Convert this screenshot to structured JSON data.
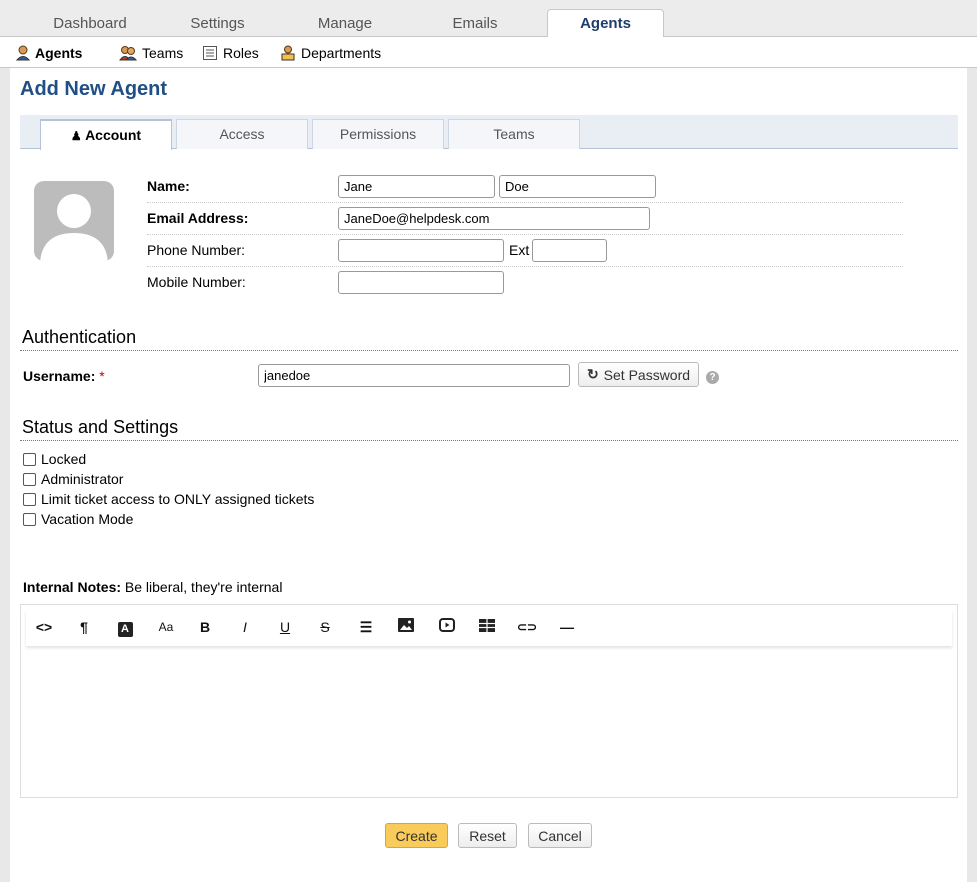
{
  "top_tabs": [
    "Dashboard",
    "Settings",
    "Manage",
    "Emails",
    "Agents"
  ],
  "sub_nav": [
    "Agents",
    "Teams",
    "Roles",
    "Departments"
  ],
  "page_title": "Add New Agent",
  "form_tabs": [
    "Account",
    "Access",
    "Permissions",
    "Teams"
  ],
  "account": {
    "name_label": "Name:",
    "first_name": "Jane",
    "last_name": "Doe",
    "email_label": "Email Address:",
    "email": "JaneDoe@helpdesk.com",
    "phone_label": "Phone Number:",
    "phone": "",
    "ext_label": "Ext",
    "ext": "",
    "mobile_label": "Mobile Number:",
    "mobile": ""
  },
  "auth": {
    "heading": "Authentication",
    "username_label": "Username:",
    "required_mark": "*",
    "username": "janedoe",
    "set_password": "Set Password"
  },
  "status": {
    "heading": "Status and Settings",
    "options": [
      "Locked",
      "Administrator",
      "Limit ticket access to ONLY assigned tickets",
      "Vacation Mode"
    ]
  },
  "notes": {
    "label": "Internal Notes:",
    "hint": "Be liberal, they're internal"
  },
  "toolbar_icons": [
    "code-view",
    "paragraph",
    "font-color",
    "font-size",
    "bold",
    "italic",
    "underline",
    "strikethrough",
    "list",
    "image",
    "video",
    "table",
    "link",
    "horizontal-rule"
  ],
  "toolbar_glyphs": {
    "code": "<>",
    "paragraph": "¶",
    "font_color": "A",
    "font_size": "Aa",
    "bold": "B",
    "italic": "I",
    "underline": "U",
    "strike": "S",
    "list": "☰",
    "link": "⊂⊃",
    "hr": "—"
  },
  "buttons": {
    "create": "Create",
    "reset": "Reset",
    "cancel": "Cancel"
  },
  "colors": {
    "title": "#1f4f85",
    "active_tab_text": "#1f3e6b",
    "required": "#cc0000",
    "primary_button": "#f8cb5a"
  }
}
